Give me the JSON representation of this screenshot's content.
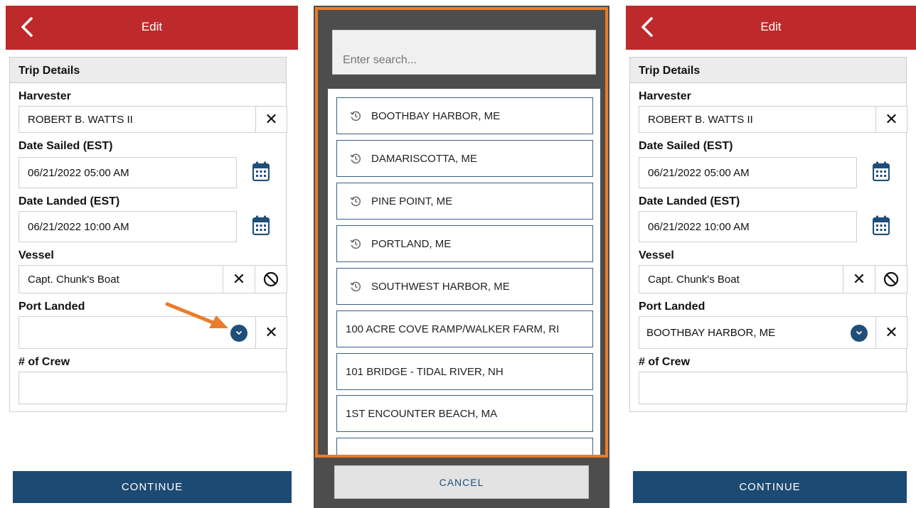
{
  "left_screen": {
    "header_title": "Edit",
    "section_title": "Trip Details",
    "harvester": {
      "label": "Harvester",
      "value": "ROBERT B. WATTS II",
      "clear": "✕"
    },
    "date_sailed": {
      "label": "Date Sailed (EST)",
      "value": "06/21/2022 05:00 AM"
    },
    "date_landed": {
      "label": "Date Landed (EST)",
      "value": "06/21/2022 10:00 AM"
    },
    "vessel": {
      "label": "Vessel",
      "value": "Capt. Chunk's Boat",
      "clear": "✕"
    },
    "port_landed": {
      "label": "Port Landed",
      "value": "",
      "clear": "✕"
    },
    "crew": {
      "label": "# of Crew",
      "value": ""
    },
    "continue_label": "CONTINUE"
  },
  "modal": {
    "search_placeholder": "Enter search...",
    "recent_ports": [
      "BOOTHBAY HARBOR, ME",
      "DAMARISCOTTA, ME",
      "PINE POINT, ME",
      "PORTLAND, ME",
      "SOUTHWEST HARBOR, ME"
    ],
    "ports": [
      "100 ACRE COVE RAMP/WALKER FARM, RI",
      "101 BRIDGE - TIDAL RIVER, NH",
      "1ST ENCOUNTER BEACH, MA"
    ],
    "cancel_label": "CANCEL"
  },
  "right_screen": {
    "header_title": "Edit",
    "section_title": "Trip Details",
    "harvester": {
      "label": "Harvester",
      "value": "ROBERT B. WATTS II",
      "clear": "✕"
    },
    "date_sailed": {
      "label": "Date Sailed (EST)",
      "value": "06/21/2022 05:00 AM"
    },
    "date_landed": {
      "label": "Date Landed (EST)",
      "value": "06/21/2022 10:00 AM"
    },
    "vessel": {
      "label": "Vessel",
      "value": "Capt. Chunk's Boat",
      "clear": "✕"
    },
    "port_landed": {
      "label": "Port Landed",
      "value": "BOOTHBAY HARBOR, ME",
      "clear": "✕"
    },
    "crew": {
      "label": "# of Crew",
      "value": ""
    },
    "continue_label": "CONTINUE"
  },
  "colors": {
    "header_red": "#be2a2b",
    "primary_blue": "#1d4a73",
    "highlight_orange": "#e97d2b",
    "modal_backdrop": "#4d4d4d"
  }
}
